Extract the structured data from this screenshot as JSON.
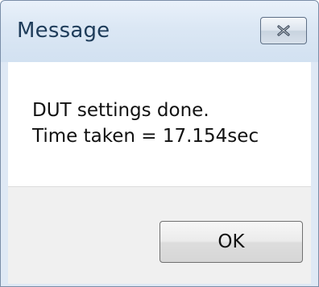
{
  "window": {
    "title": "Message"
  },
  "message": {
    "line1": "DUT settings done.",
    "line2": "Time taken = 17.154sec"
  },
  "buttons": {
    "ok_label": "OK"
  },
  "icons": {
    "close": "close-icon"
  },
  "colors": {
    "title_text": "#1e3c5a",
    "frame": "#dfe9f5",
    "content_bg": "#ffffff",
    "footer_bg": "#f0f0f0"
  }
}
